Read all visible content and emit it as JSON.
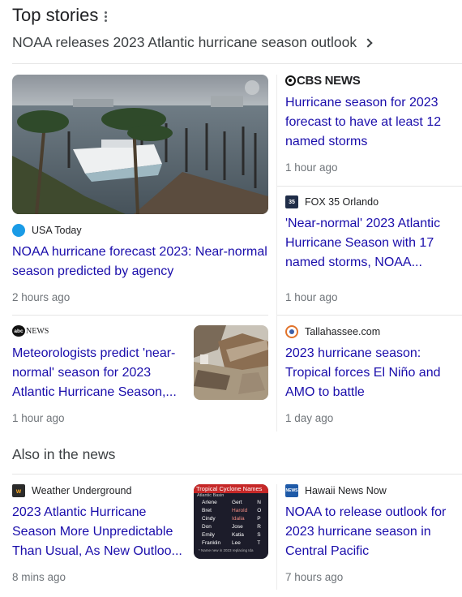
{
  "header": {
    "title": "Top stories"
  },
  "topic": {
    "label": "NOAA releases 2023 Atlantic hurricane season outlook"
  },
  "stories": [
    {
      "source": "USA Today",
      "headline": "NOAA hurricane forecast 2023: Near-normal season predicted by agency",
      "time": "2 hours ago"
    },
    {
      "source": "CBS NEWS",
      "headline": "Hurricane season for 2023 forecast to have at least 12 named storms",
      "time": "1 hour ago"
    },
    {
      "source": "FOX 35 Orlando",
      "headline": "'Near-normal' 2023 Atlantic Hurricane Season with 17 named storms, NOAA...",
      "time": "1 hour ago"
    },
    {
      "source": "NEWS",
      "headline": "Meteorologists predict 'near-normal' season for 2023 Atlantic Hurricane Season,...",
      "time": "1 hour ago"
    },
    {
      "source": "Tallahassee.com",
      "headline": "2023 hurricane season: Tropical forces El Niño and AMO to battle",
      "time": "1 day ago"
    }
  ],
  "also": {
    "title": "Also in the news",
    "stories": [
      {
        "source": "Weather Underground",
        "headline": "2023 Atlantic Hurricane Season More Unpredictable Than Usual, As New Outloo...",
        "time": "8 mins ago"
      },
      {
        "source": "Hawaii News Now",
        "headline": "NOAA to release outlook for 2023 hurricane season in Central Pacific",
        "time": "7 hours ago"
      }
    ]
  },
  "names_table": {
    "title": "Tropical Cyclone Names",
    "basin": "Atlantic Basin",
    "col1": [
      "Arlene",
      "Bret",
      "Cindy",
      "Don",
      "Emily",
      "Franklin"
    ],
    "col2": [
      "Gert",
      "Harold",
      "Idalia",
      "Jose",
      "Katia",
      "Lee"
    ],
    "col3": [
      "N",
      "O",
      "P",
      "R",
      "S",
      "T"
    ],
    "footnote": "* Name new in 2023 replacing Ida"
  },
  "colors": {
    "link": "#1a0dab",
    "muted": "#70757a",
    "divider": "#e5e5e5"
  }
}
